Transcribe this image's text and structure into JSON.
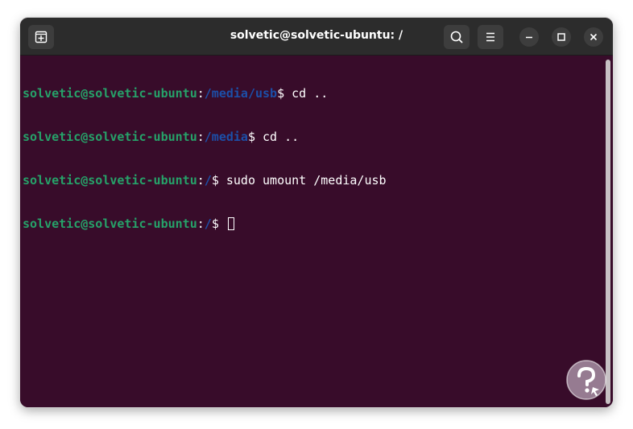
{
  "window": {
    "title": "solvetic@solvetic-ubuntu: /",
    "icons": {
      "new_tab": "new-tab-icon",
      "search": "search-icon",
      "menu": "hamburger-menu-icon",
      "minimize": "minimize-icon",
      "maximize": "maximize-icon",
      "close": "close-icon"
    }
  },
  "terminal": {
    "colors": {
      "background": "#380c2a",
      "user": "#26a269",
      "path": "#1c4fa8",
      "text": "#ffffff"
    },
    "lines": [
      {
        "user": "solvetic@solvetic-ubuntu",
        "sep": ":",
        "path": "/media/usb",
        "prompt": "$ ",
        "command": "cd .."
      },
      {
        "user": "solvetic@solvetic-ubuntu",
        "sep": ":",
        "path": "/media",
        "prompt": "$ ",
        "command": "cd .."
      },
      {
        "user": "solvetic@solvetic-ubuntu",
        "sep": ":",
        "path": "/",
        "prompt": "$ ",
        "command": "sudo umount /media/usb"
      },
      {
        "user": "solvetic@solvetic-ubuntu",
        "sep": ":",
        "path": "/",
        "prompt": "$ ",
        "command": ""
      }
    ]
  },
  "watermark": {
    "logo": "solvetic-logo"
  }
}
